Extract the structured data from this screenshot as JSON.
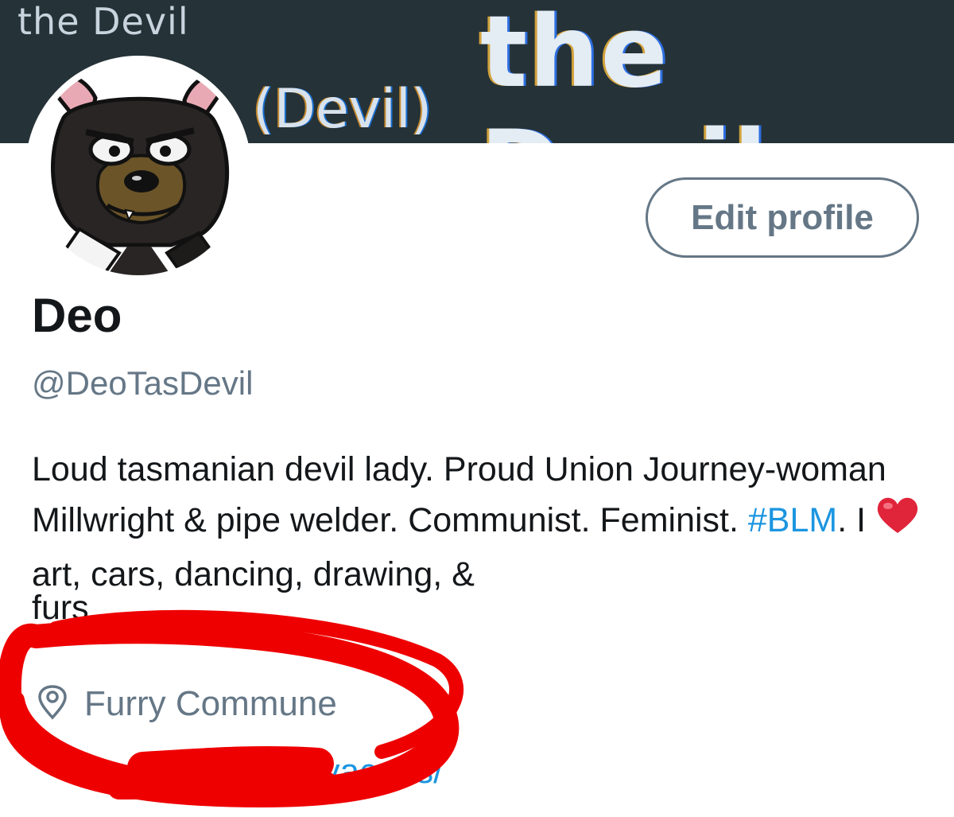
{
  "banner": {
    "small_text": "the Devil",
    "paren_text": "(Devil)",
    "big_text": "the Devil"
  },
  "profile": {
    "edit_button_label": "Edit profile",
    "display_name": "Deo",
    "handle": "@DeoTasDevil",
    "bio": {
      "part1": "Loud tasmanian devil lady. Proud Union Journey-woman Millwright & pipe welder. Communist. Feminist. ",
      "hashtag": "#BLM",
      "part2": ". I ",
      "part3": " art, cars, dancing, drawing, &",
      "fragment": "furs"
    },
    "location": "Furry Commune",
    "link_visible": "t/user/deovacuus/"
  },
  "icons": {
    "location": "location-pin-icon",
    "heart": "heart-icon",
    "avatar": "tasmanian-devil-avatar"
  },
  "colors": {
    "banner_bg": "#253237",
    "accent_link": "#1b95e0",
    "secondary_text": "#657786",
    "primary_text": "#14171a",
    "scribble_red": "#ee0000"
  }
}
